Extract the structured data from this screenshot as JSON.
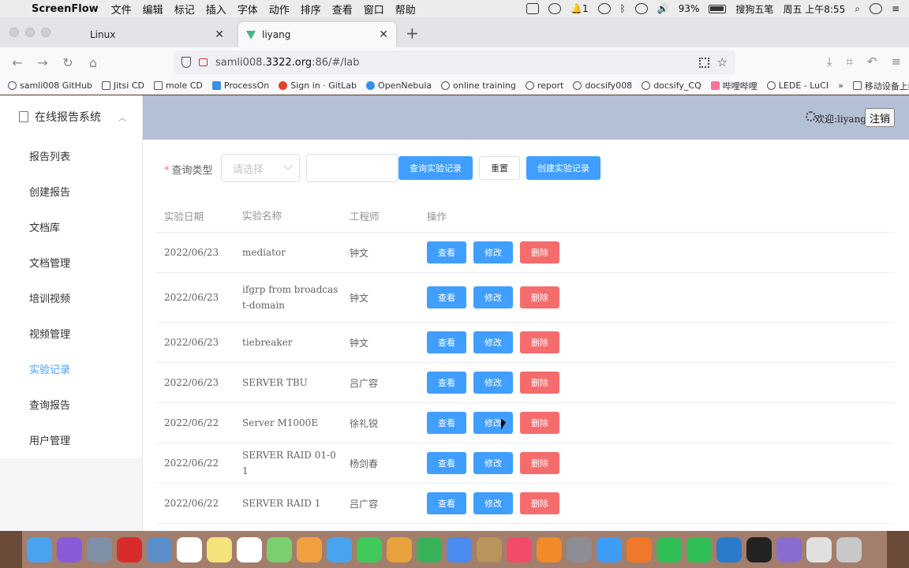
{
  "menubar": {
    "app_name": "ScreenFlow",
    "items": [
      "文件",
      "编辑",
      "标记",
      "插入",
      "字体",
      "动作",
      "排序",
      "查看",
      "窗口",
      "帮助"
    ],
    "notif_count": "1",
    "battery": "93%",
    "input_method": "搜狗五笔",
    "clock": "周五 上午8:55"
  },
  "browser": {
    "tabs": [
      {
        "label": "Linux",
        "active": false
      },
      {
        "label": "liyang",
        "active": true
      }
    ],
    "url_prefix": "samli008.",
    "url_domain": "3322.org",
    "url_suffix": ":86/#/lab",
    "bookmarks": [
      "samli008 GitHub",
      "Jitsi CD",
      "mole CD",
      "ProcessOn",
      "Sign in · GitLab",
      "OpenNebula",
      "online training",
      "report",
      "docsify008",
      "docsify_CQ",
      "哔哩哔哩",
      "LEDE - LuCI"
    ],
    "mobile_bookmarks": "移动设备上的书签"
  },
  "sidebar": {
    "title": "在线报告系统",
    "items": [
      {
        "label": "报告列表",
        "active": false
      },
      {
        "label": "创建报告",
        "active": false
      },
      {
        "label": "文档库",
        "active": false
      },
      {
        "label": "文档管理",
        "active": false
      },
      {
        "label": "培训视频",
        "active": false
      },
      {
        "label": "视频管理",
        "active": false
      },
      {
        "label": "实验记录",
        "active": true
      },
      {
        "label": "查询报告",
        "active": false
      },
      {
        "label": "用户管理",
        "active": false
      }
    ]
  },
  "header": {
    "welcome": "欢迎:liyang",
    "logout": "注销"
  },
  "filter": {
    "label": "查询类型",
    "select_placeholder": "请选择",
    "query_button": "查询实验记录",
    "reset_button": "重置",
    "create_button": "创建实验记录"
  },
  "table": {
    "columns": [
      "实验日期",
      "实验名称",
      "工程师",
      "操作"
    ],
    "rows": [
      {
        "date": "2022/06/23",
        "name": "mediator",
        "engineer": "钟文"
      },
      {
        "date": "2022/06/23",
        "name": "ifgrp from broadcast-domain",
        "engineer": "钟文"
      },
      {
        "date": "2022/06/23",
        "name": "tiebreaker",
        "engineer": "钟文"
      },
      {
        "date": "2022/06/23",
        "name": "SERVER TBU",
        "engineer": "吕广容"
      },
      {
        "date": "2022/06/22",
        "name": "Server M1000E",
        "engineer": "徐礼锐"
      },
      {
        "date": "2022/06/22",
        "name": "SERVER RAID 01-01",
        "engineer": "杨剑春"
      },
      {
        "date": "2022/06/22",
        "name": "SERVER RAID 1",
        "engineer": "吕广容"
      }
    ],
    "actions": {
      "view": "查看",
      "edit": "修改",
      "delete": "删除"
    }
  },
  "colors": {
    "primary": "#409eff",
    "danger": "#f56c6c",
    "header_bg": "#b4c0d6"
  },
  "dock_apps": [
    "finder",
    "siri",
    "launchpad",
    "opera",
    "preview",
    "calendar",
    "notes",
    "reminders",
    "maps",
    "photos",
    "messages",
    "facetime",
    "keynote-alt",
    "numbers",
    "keynote",
    "archive",
    "music",
    "books",
    "system-preferences",
    "safari",
    "firefox",
    "wechat",
    "wechat-work",
    "vscode",
    "qq",
    "screenflow",
    "pdf",
    "trash"
  ],
  "dock_colors": [
    "#4aa3f0",
    "#8a5bd8",
    "#7f8fa6",
    "#d92b2b",
    "#5a8fc9",
    "#ffffff",
    "#f5e27a",
    "#ffffff",
    "#7ccf6e",
    "#f0a040",
    "#4aa3f0",
    "#3fca5a",
    "#e8a23b",
    "#38b25a",
    "#4a8cf0",
    "#b9955b",
    "#f24a6a",
    "#f08a2a",
    "#8d8d94",
    "#3d9cf5",
    "#f0782a",
    "#2fbe55",
    "#2fbe55",
    "#2b7acc",
    "#222222",
    "#8a6bd0",
    "#e0e0e0",
    "#c8c8c8"
  ]
}
